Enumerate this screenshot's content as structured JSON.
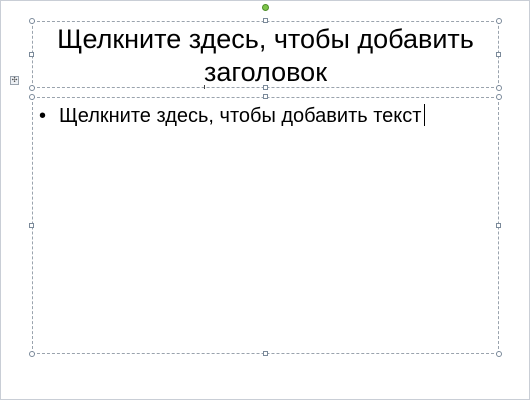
{
  "slide": {
    "title_placeholder": "Щелкните здесь, чтобы добавить заголовок",
    "body_placeholder": "Щелкните здесь, чтобы добавить текст",
    "bullet": "•"
  },
  "icons": {
    "rotate": "rotate-handle-icon",
    "move": "move-handle-icon"
  },
  "colors": {
    "placeholder_border": "#9aa3ad",
    "rotate_handle": "#7ec44a"
  }
}
